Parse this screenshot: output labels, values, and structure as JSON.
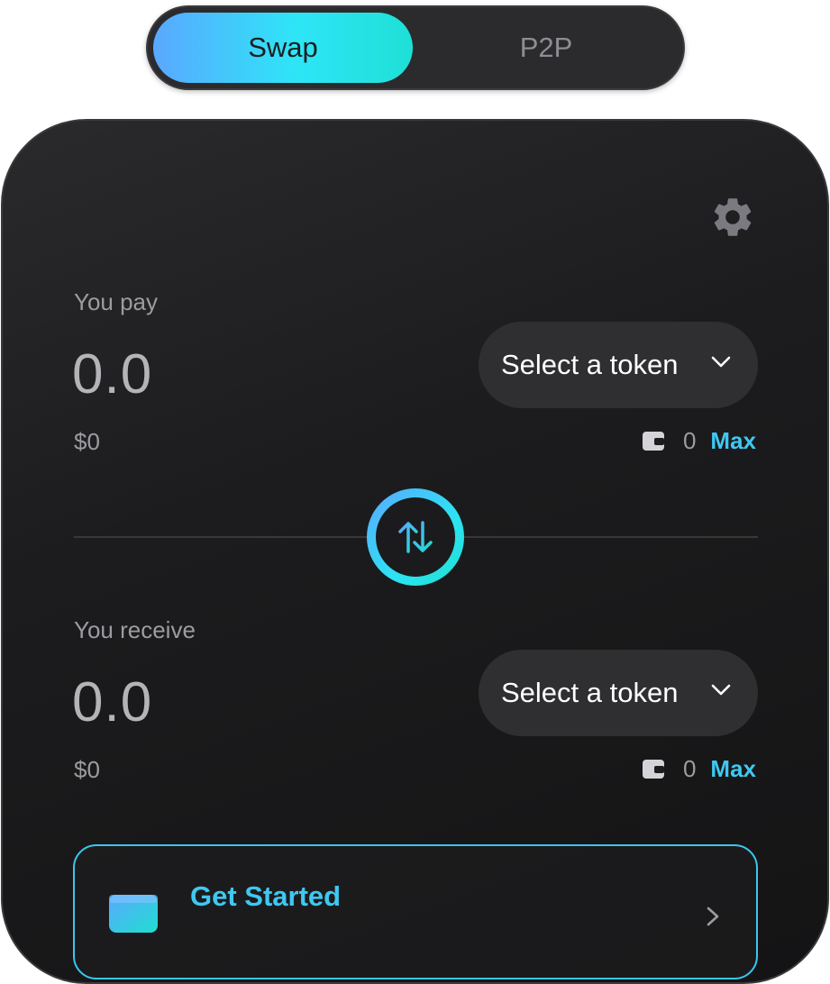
{
  "toggle": {
    "options": [
      {
        "label": "Swap",
        "active": true
      },
      {
        "label": "P2P",
        "active": false
      }
    ]
  },
  "swap": {
    "settings_icon": "gear-icon",
    "pay": {
      "label": "You pay",
      "amount": "0.0",
      "usd": "$0",
      "token_button": "Select a token",
      "balance": "0",
      "max_label": "Max"
    },
    "receive": {
      "label": "You receive",
      "amount": "0.0",
      "usd": "$0",
      "token_button": "Select a token",
      "balance": "0",
      "max_label": "Max"
    },
    "switch_icon": "swap-arrows-icon"
  },
  "get_started": {
    "title": "Get Started",
    "icon": "wallet-icon"
  },
  "colors": {
    "accent": "#3ec8f2",
    "gradient_start": "#5aa8ff",
    "gradient_end": "#1ee0d6",
    "card_bg": "#1c1c1e",
    "token_button_bg": "#2f2f31"
  }
}
